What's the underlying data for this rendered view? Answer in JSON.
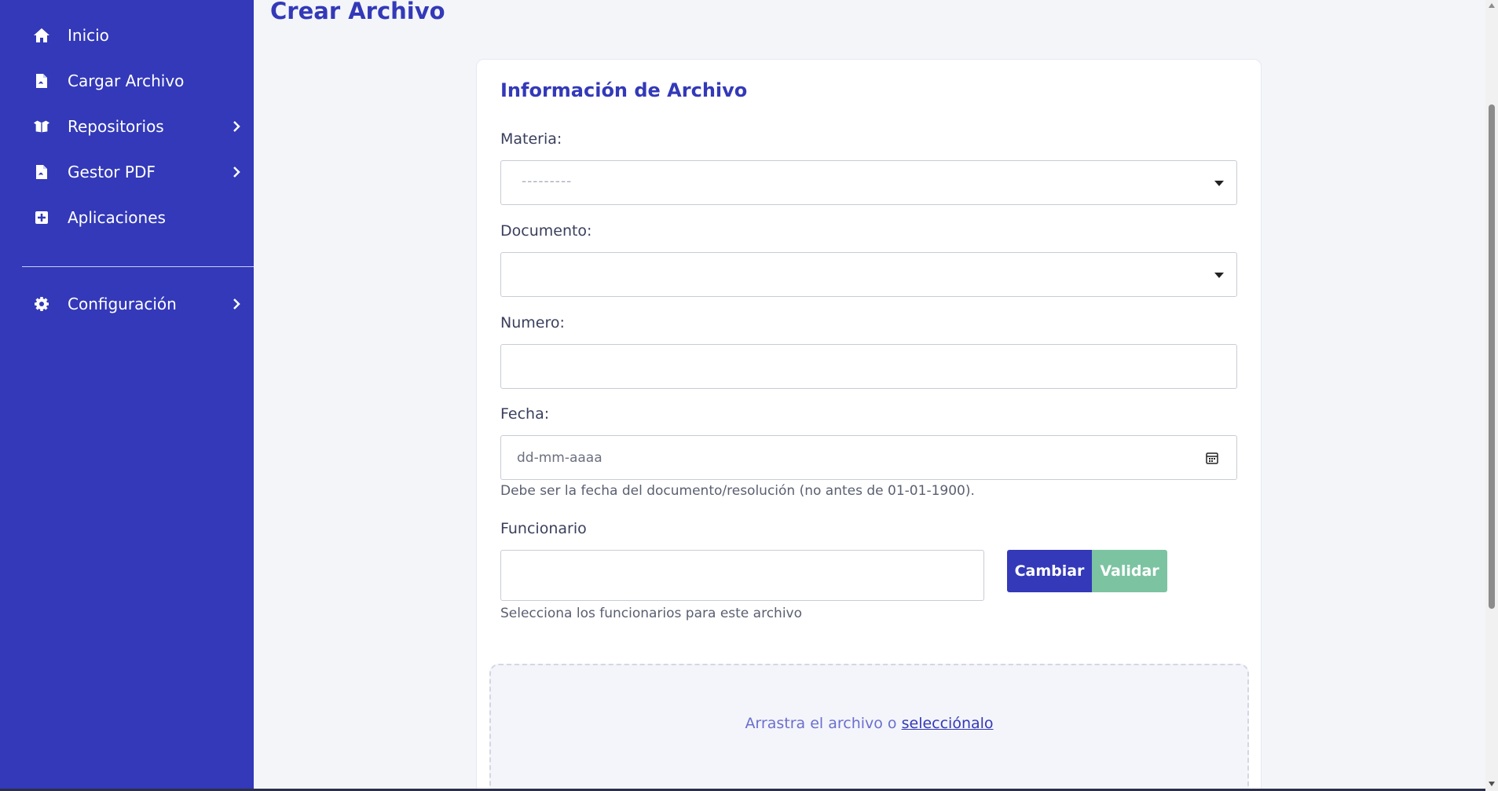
{
  "sidebar": {
    "items": [
      {
        "label": "Inicio",
        "icon": "home-icon"
      },
      {
        "label": "Cargar Archivo",
        "icon": "file-pdf-icon"
      },
      {
        "label": "Repositorios",
        "icon": "boxes-icon",
        "has_submenu": true
      },
      {
        "label": "Gestor PDF",
        "icon": "file-pdf-icon",
        "has_submenu": true
      },
      {
        "label": "Aplicaciones",
        "icon": "plus-square-icon"
      }
    ],
    "settings": {
      "label": "Configuración",
      "icon": "gear-icon",
      "has_submenu": true
    }
  },
  "main": {
    "title": "Crear Archivo"
  },
  "form": {
    "title": "Información de Archivo",
    "materia": {
      "label": "Materia:",
      "placeholder": "---------"
    },
    "documento": {
      "label": "Documento:",
      "value": ""
    },
    "numero": {
      "label": "Numero:",
      "value": ""
    },
    "fecha": {
      "label": "Fecha:",
      "placeholder": "dd-mm-aaaa",
      "help": "Debe ser la fecha del documento/resolución (no antes de 01-01-1900)."
    },
    "funcionario": {
      "label": "Funcionario",
      "value": "",
      "help": "Selecciona los funcionarios para este archivo",
      "cambiar_label": "Cambiar",
      "validar_label": "Validar"
    },
    "dropzone": {
      "text": "Arrastra el archivo o ",
      "link": "selecciónalo"
    }
  },
  "colors": {
    "sidebar_bg": "#3339b8",
    "accent": "#3339b8",
    "validar_bg": "#7cc3a2",
    "page_bg": "#f3f5f9"
  }
}
